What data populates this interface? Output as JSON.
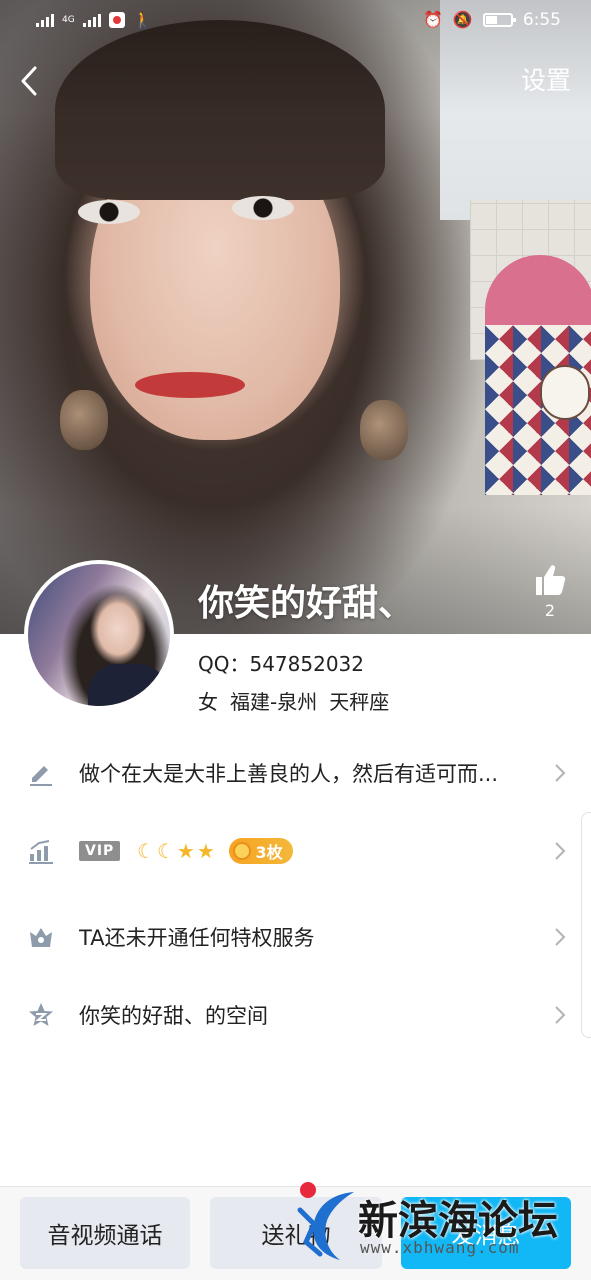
{
  "status_bar": {
    "network_label": "4G",
    "time": "6:55",
    "battery_percent": 45,
    "icons": [
      "signal-x-icon",
      "signal-4g-icon",
      "app-notification-icon",
      "walk-icon",
      "alarm-icon",
      "bell-off-icon",
      "battery-icon"
    ]
  },
  "nav": {
    "back_icon": "back-chevron-icon",
    "settings_label": "设置"
  },
  "profile": {
    "nickname": "你笑的好甜、",
    "likes_count": "2",
    "qq_line": "QQ：547852032",
    "gender": "女",
    "location": "福建-泉州",
    "zodiac": "天秤座"
  },
  "list": {
    "signature": {
      "icon": "pencil-icon",
      "text": "做个在大是大非上善良的人，然后有适可而..."
    },
    "level": {
      "icon": "level-up-icon",
      "vip_label": "VIP",
      "level_icons": [
        "moon",
        "moon",
        "star",
        "star"
      ],
      "coin_text": "3枚"
    },
    "privilege": {
      "icon": "crown-icon",
      "text": "TA还未开通任何特权服务"
    },
    "space": {
      "icon": "qzone-star-icon",
      "text": "你笑的好甜、的空间"
    }
  },
  "bottom_bar": {
    "call_label": "音视频通话",
    "gift_label": "送礼物",
    "primary_label": "发消息"
  },
  "watermark": {
    "title": "新滨海论坛",
    "url": "www.xbhwang.com"
  },
  "colors": {
    "accent": "#12b7f5",
    "coin": "#f7a321",
    "icon_gray": "#8e9bab",
    "watermark_red": "#e8283c",
    "watermark_blue": "#1e6fd0"
  }
}
